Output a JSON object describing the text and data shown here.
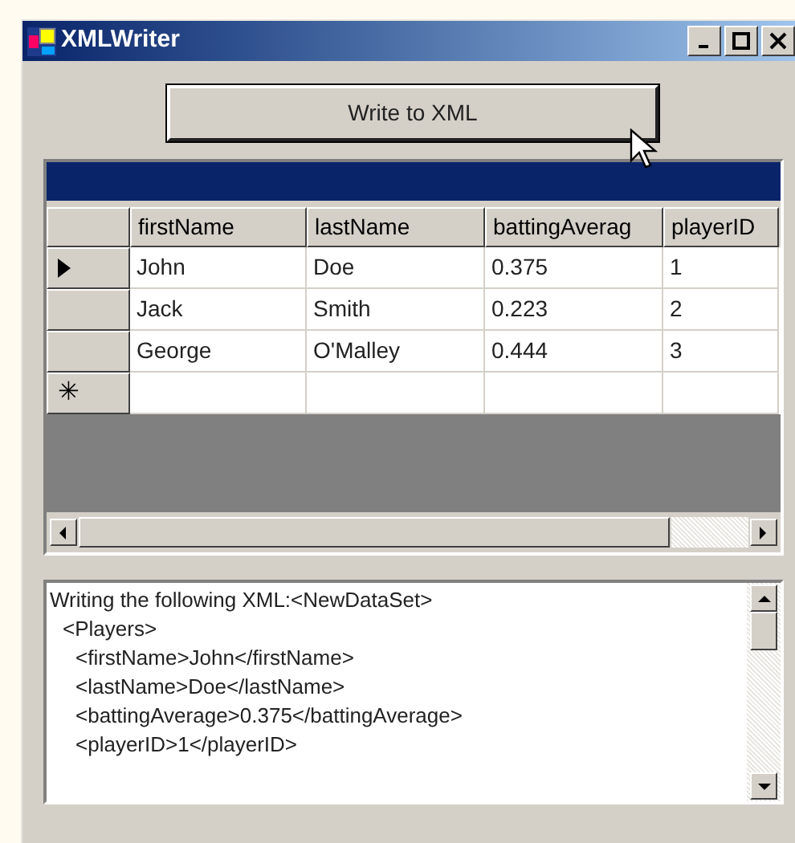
{
  "window": {
    "title": "XMLWriter"
  },
  "write_button": {
    "label": "Write to XML"
  },
  "grid": {
    "columns": [
      "firstName",
      "lastName",
      "battingAverag",
      "playerID"
    ],
    "rows": [
      {
        "selected": true,
        "cells": [
          "John",
          "Doe",
          "0.375",
          "1"
        ]
      },
      {
        "selected": false,
        "cells": [
          "Jack",
          "Smith",
          "0.223",
          "2"
        ]
      },
      {
        "selected": false,
        "cells": [
          "George",
          "O'Malley",
          "0.444",
          "3"
        ]
      }
    ],
    "new_row_marker": "✳"
  },
  "output": {
    "lines": [
      {
        "text": "Writing the following XML:<NewDataSet>",
        "children": [
          {
            "text": "<Players>",
            "children": [
              {
                "text": "<firstName>John</firstName>"
              },
              {
                "text": "<lastName>Doe</lastName>"
              },
              {
                "text": "<battingAverage>0.375</battingAverage>"
              },
              {
                "text": "<playerID>1</playerID>"
              }
            ]
          }
        ]
      }
    ]
  }
}
